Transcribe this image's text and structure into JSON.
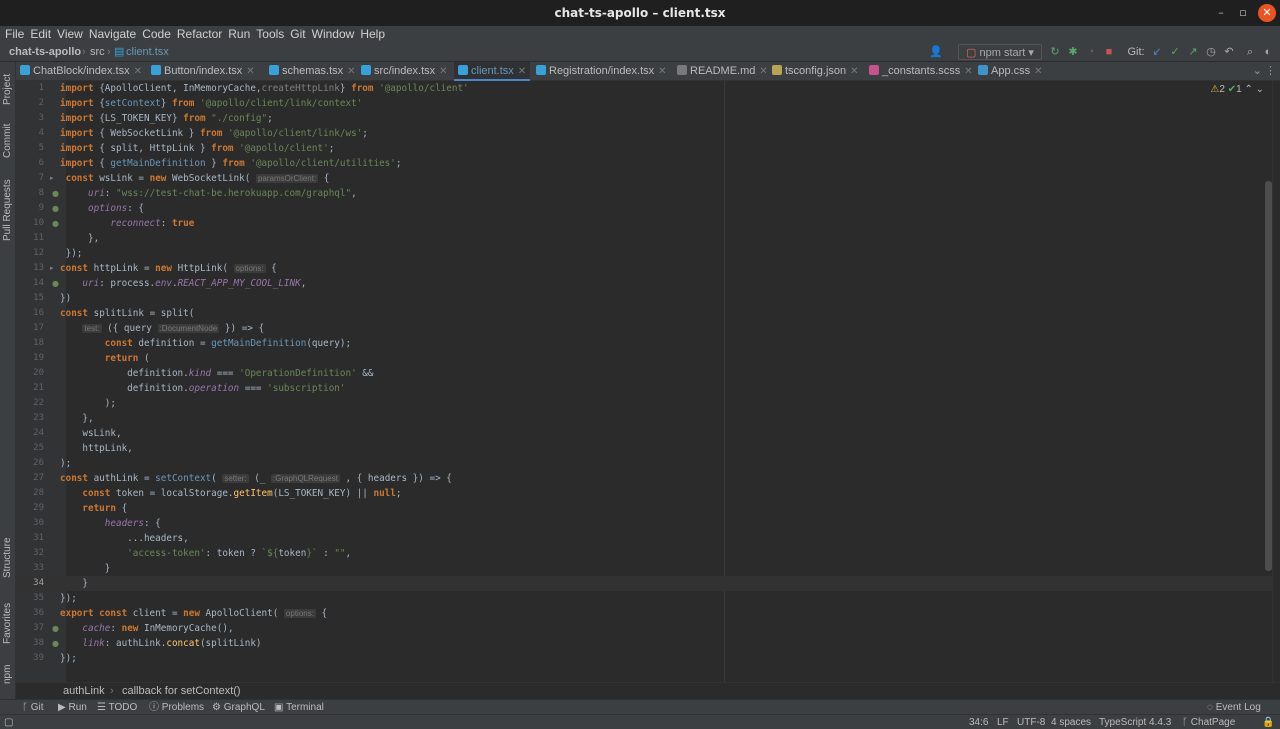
{
  "window": {
    "title": "chat-ts-apollo – client.tsx"
  },
  "menu": [
    "File",
    "Edit",
    "View",
    "Navigate",
    "Code",
    "Refactor",
    "Run",
    "Tools",
    "Git",
    "Window",
    "Help"
  ],
  "breadcrumb": {
    "project": "chat-ts-apollo",
    "folder": "src",
    "file": "client.tsx"
  },
  "toolbar": {
    "run_config": "npm start",
    "git_label": "Git:"
  },
  "tabs": [
    {
      "label": "ChatBlock/index.tsx",
      "icon": "tsx"
    },
    {
      "label": "Button/index.tsx",
      "icon": "tsx"
    },
    {
      "label": "schemas.tsx",
      "icon": "tsx"
    },
    {
      "label": "src/index.tsx",
      "icon": "tsx"
    },
    {
      "label": "client.tsx",
      "icon": "tsx",
      "active": true
    },
    {
      "label": "Registration/index.tsx",
      "icon": "tsx"
    },
    {
      "label": "README.md",
      "icon": "md"
    },
    {
      "label": "tsconfig.json",
      "icon": "json"
    },
    {
      "label": "_constants.scss",
      "icon": "scss"
    },
    {
      "label": "App.css",
      "icon": "css"
    }
  ],
  "left_tools": {
    "project": "Project",
    "commit": "Commit",
    "pull_requests": "Pull Requests",
    "structure": "Structure",
    "favorites": "Favorites",
    "npm": "npm"
  },
  "inspections": {
    "warnings": "2",
    "ok": "1"
  },
  "hints": {
    "paramsOrClient": "paramsOrClient:",
    "options": "options:",
    "test": "test:",
    "documentNode": ":DocumentNode",
    "setter": "setter:",
    "graphQLRequest": ":GraphQLRequest",
    "options2": "options:"
  },
  "editor_breadcrumb": {
    "first": "authLink",
    "second": "callback for setContext()"
  },
  "tool_windows": [
    "Git",
    "Run",
    "TODO",
    "Problems",
    "GraphQL",
    "Terminal"
  ],
  "event_log": "Event Log",
  "status": {
    "position": "34:6",
    "line_sep": "LF",
    "encoding": "UTF-8",
    "indent": "4 spaces",
    "language": "TypeScript 4.4.3",
    "branch": "ChatPage"
  }
}
